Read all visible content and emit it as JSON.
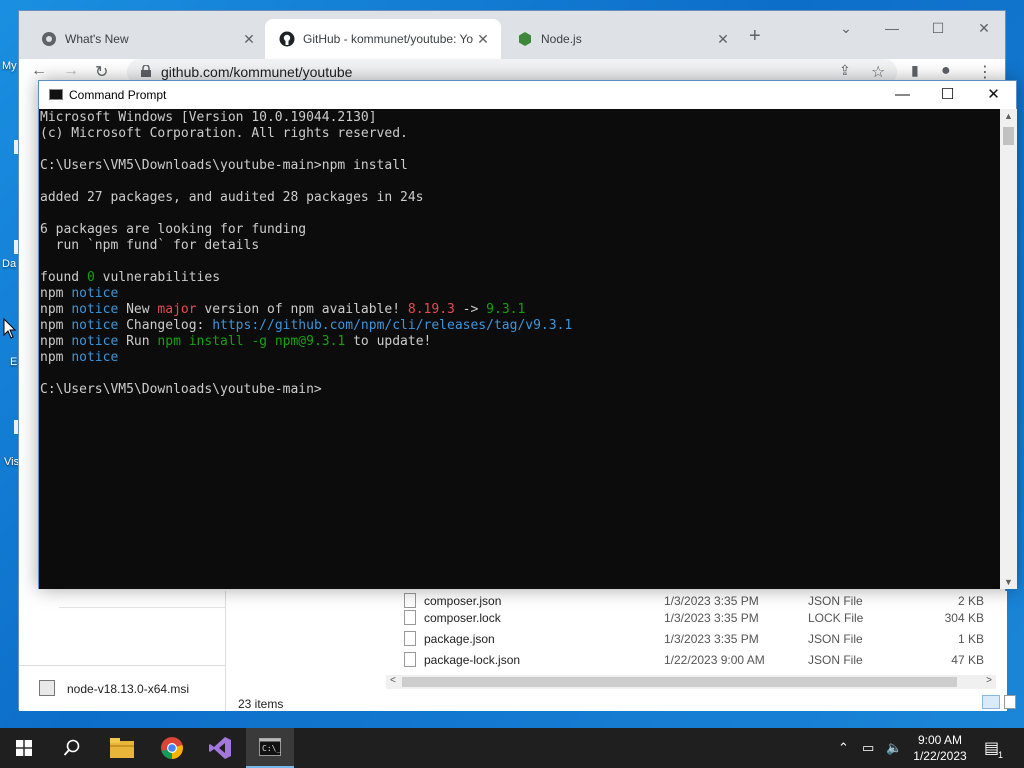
{
  "desktop": {
    "labels": [
      "My",
      "Da",
      "E",
      "Vis"
    ]
  },
  "browser": {
    "tabs": [
      {
        "title": "What's New",
        "icon": "chrome-icon"
      },
      {
        "title": "GitHub - kommunet/youtube: Yo",
        "icon": "github-icon"
      },
      {
        "title": "Node.js",
        "icon": "nodejs-icon"
      }
    ],
    "active_tab": 1,
    "url": "github.com/kommunet/youtube",
    "new_tab_label": "+",
    "close_glyph": "✕"
  },
  "downloads": {
    "file": "node-v18.13.0-x64.msi"
  },
  "explorer": {
    "files": [
      {
        "name": "composer.json",
        "date": "1/3/2023 3:35 PM",
        "type": "JSON File",
        "size": "2 KB"
      },
      {
        "name": "composer.lock",
        "date": "1/3/2023 3:35 PM",
        "type": "LOCK File",
        "size": "304 KB"
      },
      {
        "name": "package.json",
        "date": "1/3/2023 3:35 PM",
        "type": "JSON File",
        "size": "1 KB"
      },
      {
        "name": "package-lock.json",
        "date": "1/22/2023 9:00 AM",
        "type": "JSON File",
        "size": "47 KB"
      }
    ],
    "status": "23 items"
  },
  "cmd": {
    "title": "Command Prompt",
    "minimize": "—",
    "maximize": "☐",
    "close": "✕",
    "lines": [
      [
        {
          "t": "Microsoft Windows [Version 10.0.19044.2130]"
        }
      ],
      [
        {
          "t": "(c) Microsoft Corporation. All rights reserved."
        }
      ],
      [],
      [
        {
          "t": "C:\\Users\\VM5\\Downloads\\youtube-main>npm install"
        }
      ],
      [],
      [
        {
          "t": "added 27 packages, and audited 28 packages in 24s"
        }
      ],
      [],
      [
        {
          "t": "6 packages are looking for funding"
        }
      ],
      [
        {
          "t": "  run `npm fund` for details"
        }
      ],
      [],
      [
        {
          "t": "found "
        },
        {
          "t": "0",
          "c": "green"
        },
        {
          "t": " vulnerabilities"
        }
      ],
      [
        {
          "t": "npm "
        },
        {
          "t": "notice",
          "c": "cyan"
        }
      ],
      [
        {
          "t": "npm "
        },
        {
          "t": "notice",
          "c": "cyan"
        },
        {
          "t": " New "
        },
        {
          "t": "major",
          "c": "red"
        },
        {
          "t": " version of npm available! "
        },
        {
          "t": "8.19.3",
          "c": "red"
        },
        {
          "t": " -> "
        },
        {
          "t": "9.3.1",
          "c": "green"
        }
      ],
      [
        {
          "t": "npm "
        },
        {
          "t": "notice",
          "c": "cyan"
        },
        {
          "t": " Changelog: "
        },
        {
          "t": "https://github.com/npm/cli/releases/tag/v9.3.1",
          "c": "cyan"
        }
      ],
      [
        {
          "t": "npm "
        },
        {
          "t": "notice",
          "c": "cyan"
        },
        {
          "t": " Run "
        },
        {
          "t": "npm install -g npm@9.3.1",
          "c": "green"
        },
        {
          "t": " to update!"
        }
      ],
      [
        {
          "t": "npm "
        },
        {
          "t": "notice",
          "c": "cyan"
        }
      ],
      [],
      [
        {
          "t": "C:\\Users\\VM5\\Downloads\\youtube-main>"
        }
      ]
    ]
  },
  "taskbar": {
    "apps": [
      "start-icon",
      "search-icon",
      "file-explorer-icon",
      "chrome-icon",
      "visual-studio-icon",
      "command-prompt-icon"
    ],
    "clock_time": "9:00 AM",
    "clock_date": "1/22/2023",
    "notification_count": "1"
  },
  "colors": {
    "console_bg": "#0c0c0c",
    "console_fg": "#cccccc",
    "cyan": "#3a96dd",
    "red": "#e74856",
    "green": "#13a10e",
    "taskbar": "#1f1f1f"
  }
}
